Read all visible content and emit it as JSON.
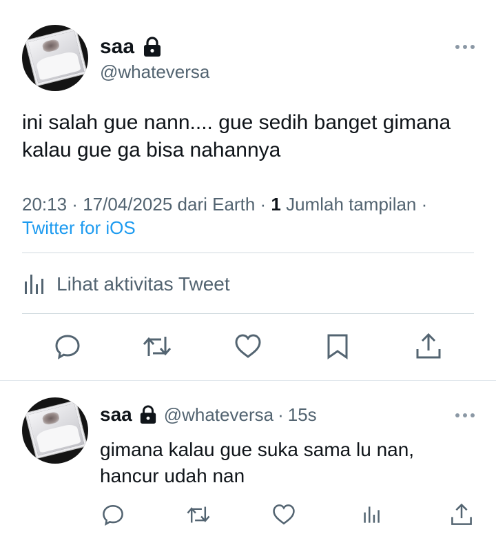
{
  "main_tweet": {
    "author": {
      "name": "saa",
      "handle": "@whateversa",
      "protected_icon": "lock-icon"
    },
    "text": "ini salah gue nann.... gue sedih banget gimana kalau gue ga bisa nahannya",
    "meta": {
      "time": "20:13",
      "sep1": " · ",
      "date": "17/04/2025",
      "location": " dari Earth",
      "sep2": " · ",
      "views_count": "1",
      "views_label": " Jumlah tampilan ·",
      "source": "Twitter for iOS"
    },
    "activity_label": "Lihat aktivitas Tweet",
    "actions": [
      "reply-icon",
      "retweet-icon",
      "like-icon",
      "bookmark-icon",
      "share-icon"
    ]
  },
  "reply": {
    "author": {
      "name": "saa",
      "handle": "@whateversa",
      "separator": "·",
      "time": "15s"
    },
    "text_line1": "gimana kalau gue suka sama lu nan,",
    "text_line2": "hancur udah nan",
    "actions": [
      "reply-icon",
      "retweet-icon",
      "like-icon",
      "views-icon",
      "share-icon"
    ]
  },
  "colors": {
    "text": "#0f1419",
    "secondary": "#536471",
    "link": "#1d9bf0",
    "divider": "#cfd9de"
  }
}
